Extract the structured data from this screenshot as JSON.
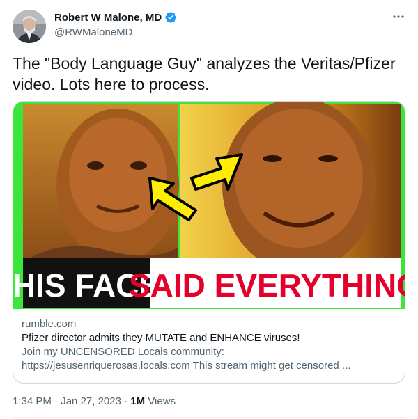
{
  "author": {
    "display_name": "Robert W Malone, MD",
    "handle": "@RWMaloneMD",
    "avatar_icon": "avatar-photo",
    "verified_icon": "verified-badge-icon",
    "verified_color": "#1d9bf0"
  },
  "more_icon": "more-options-icon",
  "tweet_text": "The \"Body Language Guy\" analyzes the Veritas/Pfizer video.  Lots here to process.",
  "card": {
    "thumbnail": {
      "caption_left": "HIS FACE",
      "caption_right": "SAID EVERYTHING",
      "border_color": "#39e639",
      "arrow_color": "#ffee00",
      "caption_right_color": "#e4002b"
    },
    "domain": "rumble.com",
    "title": "Pfizer director admits they MUTATE and ENHANCE viruses!",
    "description_line1": "Join my UNCENSORED Locals community:",
    "description_line2": "https://jesusenriquerosas.locals.com This stream might get censored ..."
  },
  "footer": {
    "time": "1:34 PM",
    "separator": "·",
    "date": "Jan 27, 2023",
    "views_count": "1M",
    "views_label": "Views"
  }
}
